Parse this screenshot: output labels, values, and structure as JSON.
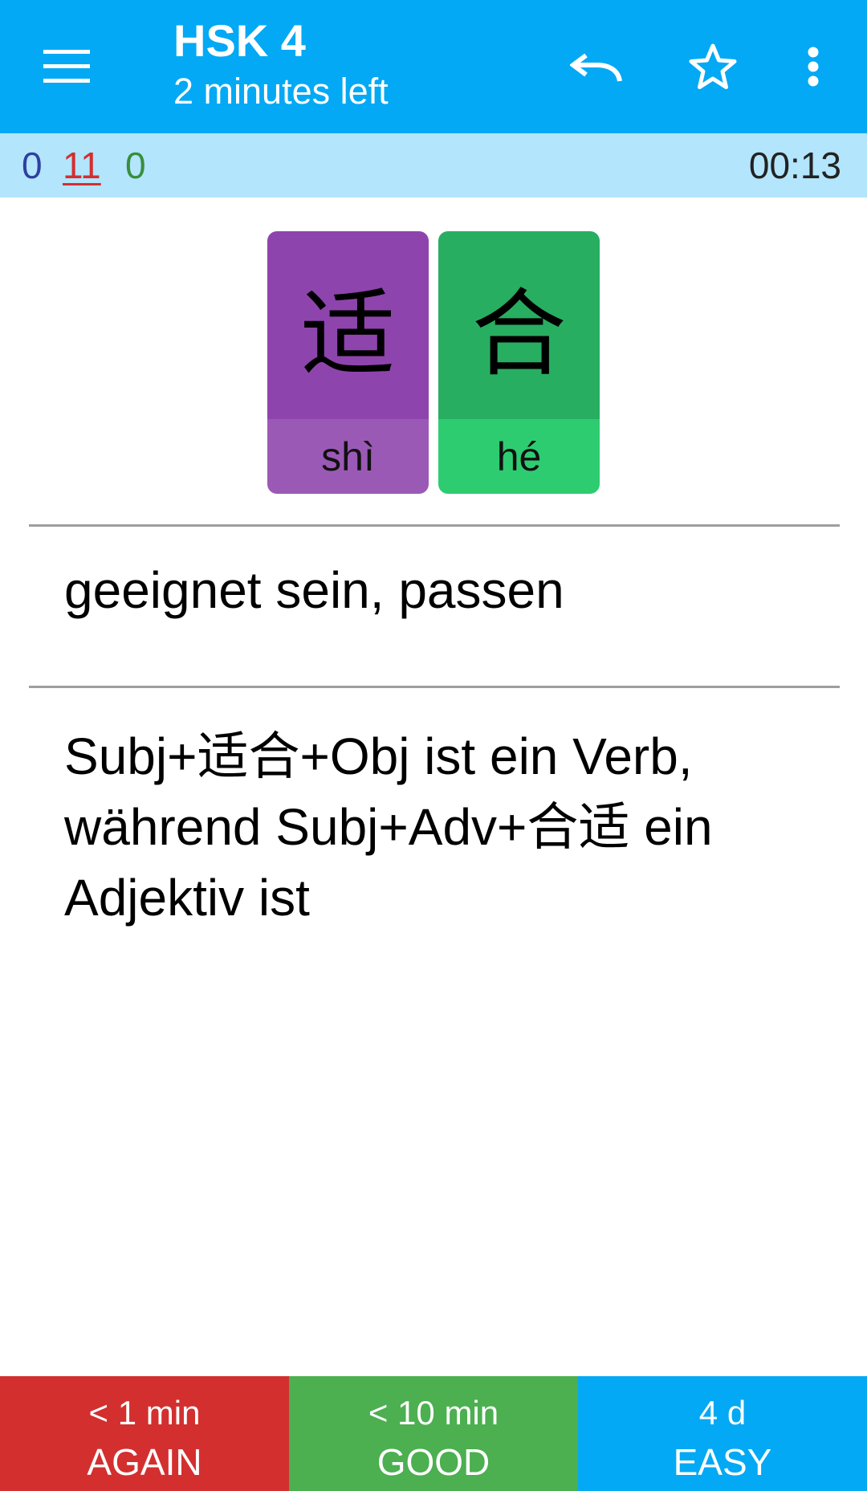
{
  "appbar": {
    "title": "HSK 4",
    "subtitle": "2 minutes left",
    "background": "#03A9F4",
    "icons": [
      "menu-icon",
      "undo-icon",
      "star-outline-icon",
      "more-vert-icon"
    ]
  },
  "counts": {
    "new": "0",
    "learning": "11",
    "review": "0",
    "timer": "00:13",
    "colors": {
      "new": "#303F9F",
      "learning": "#D32F2F",
      "review": "#388E3C",
      "bar": "#B3E5FC"
    }
  },
  "characters": [
    {
      "hanzi": "适",
      "pinyin": "shì",
      "top_color": "#8E44AD",
      "bottom_color": "#9B59B6"
    },
    {
      "hanzi": "合",
      "pinyin": "hé",
      "top_color": "#27AE60",
      "bottom_color": "#2ECC71"
    }
  ],
  "card": {
    "meaning": "geeignet sein, passen",
    "note": "Subj+适合+Obj ist ein Verb, während Subj+Adv+合适 ein Adjektiv ist"
  },
  "answers": [
    {
      "interval": "< 1 min",
      "label": "AGAIN",
      "color": "#D32F2F"
    },
    {
      "interval": "< 10 min",
      "label": "GOOD",
      "color": "#4CAF50"
    },
    {
      "interval": "4 d",
      "label": "EASY",
      "color": "#03A9F4"
    }
  ]
}
